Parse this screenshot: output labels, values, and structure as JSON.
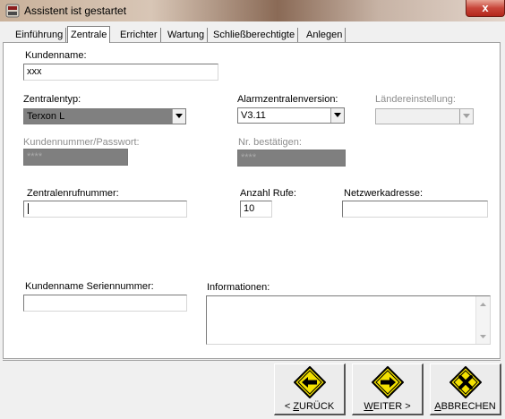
{
  "window": {
    "title": "Assistent ist gestartet",
    "close_glyph": "x"
  },
  "tabs": [
    {
      "label": "Einführung",
      "active": false
    },
    {
      "label": "Zentrale",
      "active": true
    },
    {
      "label": "Errichter",
      "active": false
    },
    {
      "label": "Wartung",
      "active": false
    },
    {
      "label": "Schließberechtigte",
      "active": false
    },
    {
      "label": "Anlegen",
      "active": false
    }
  ],
  "form": {
    "kundenname": {
      "label": "Kundenname:",
      "value": "xxx"
    },
    "zentralentyp": {
      "label": "Zentralentyp:",
      "value": "Terxon L"
    },
    "alarmzentralenversion": {
      "label": "Alarmzentralenversion:",
      "value": "V3.11"
    },
    "laendereinstellung": {
      "label": "Ländereinstellung:",
      "value": ""
    },
    "kundennummer_passwort": {
      "label": "Kundennummer/Passwort:",
      "value": "****"
    },
    "nr_bestaetigen": {
      "label": "Nr. bestätigen:",
      "value": "****"
    },
    "zentralenrufnummer": {
      "label": "Zentralenrufnummer:",
      "value": ""
    },
    "anzahl_rufe": {
      "label": "Anzahl Rufe:",
      "value": "10"
    },
    "netzwerkadresse": {
      "label": "Netzwerkadresse:",
      "value": ""
    },
    "kundenname_seriennummer": {
      "label": "Kundenname Seriennummer:",
      "value": ""
    },
    "informationen": {
      "label": "Informationen:",
      "value": ""
    }
  },
  "buttons": {
    "back": {
      "mnemonic": "Z",
      "rest": "URÜCK",
      "prefix": "< ",
      "icon": "arrow-left-icon"
    },
    "next": {
      "mnemonic": "W",
      "rest": "EITER",
      "suffix": " >",
      "icon": "arrow-right-icon"
    },
    "cancel": {
      "mnemonic": "A",
      "rest": "BBRECHEN",
      "icon": "cross-icon"
    }
  },
  "colors": {
    "sign_yellow": "#f4e200",
    "sign_border": "#000000",
    "readonly_gray": "#7f7f7f",
    "close_red": "#c8463a"
  }
}
